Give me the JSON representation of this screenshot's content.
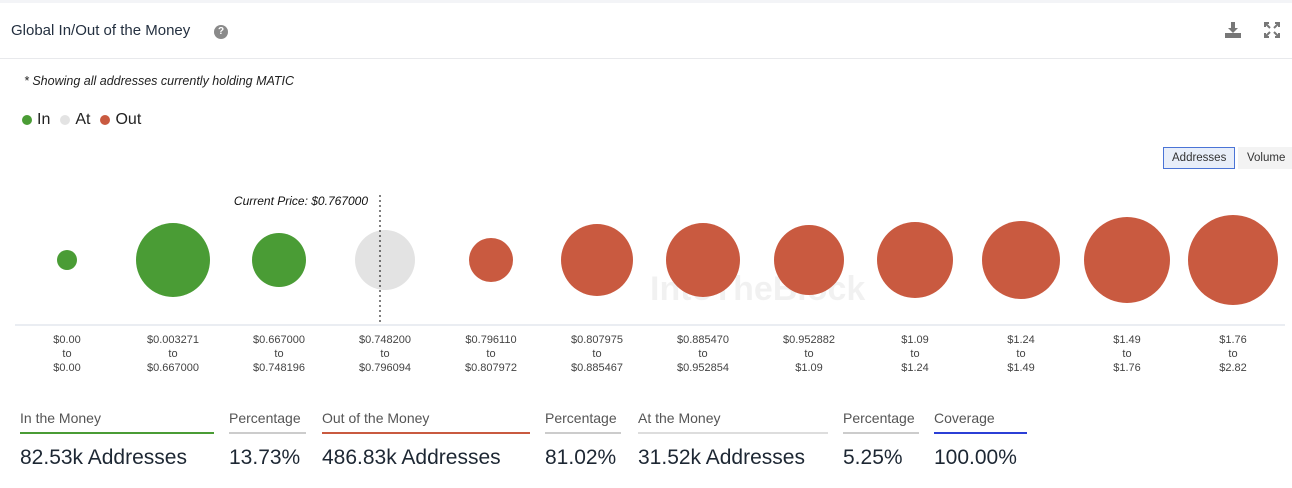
{
  "header": {
    "title": "Global In/Out of the Money",
    "help_icon": "question-circle-icon",
    "download_icon": "download-icon",
    "expand_icon": "expand-icon"
  },
  "note": "* Showing all addresses currently holding MATIC",
  "legend": [
    {
      "label": "In",
      "color": "#4a9c35"
    },
    {
      "label": "At",
      "color": "#e3e3e3"
    },
    {
      "label": "Out",
      "color": "#c95a40"
    }
  ],
  "toggles": {
    "addresses": "Addresses",
    "volume": "Volume",
    "active": "Addresses"
  },
  "watermark": "IntoTheBlock",
  "chart_data": {
    "type": "bubble",
    "current_price_label": "Current Price: $0.767000",
    "current_price_bucket_index": 3,
    "buckets": [
      {
        "from": "$0.00",
        "to": "$0.00",
        "status": "In",
        "relative_size": 10
      },
      {
        "from": "$0.003271",
        "to": "$0.667000",
        "status": "In",
        "relative_size": 37
      },
      {
        "from": "$0.667000",
        "to": "$0.748196",
        "status": "In",
        "relative_size": 27
      },
      {
        "from": "$0.748200",
        "to": "$0.796094",
        "status": "At",
        "relative_size": 30
      },
      {
        "from": "$0.796110",
        "to": "$0.807972",
        "status": "Out",
        "relative_size": 22
      },
      {
        "from": "$0.807975",
        "to": "$0.885467",
        "status": "Out",
        "relative_size": 36
      },
      {
        "from": "$0.885470",
        "to": "$0.952854",
        "status": "Out",
        "relative_size": 37
      },
      {
        "from": "$0.952882",
        "to": "$1.09",
        "status": "Out",
        "relative_size": 35
      },
      {
        "from": "$1.09",
        "to": "$1.24",
        "status": "Out",
        "relative_size": 38
      },
      {
        "from": "$1.24",
        "to": "$1.49",
        "status": "Out",
        "relative_size": 39
      },
      {
        "from": "$1.49",
        "to": "$1.76",
        "status": "Out",
        "relative_size": 43
      },
      {
        "from": "$1.76",
        "to": "$2.82",
        "status": "Out",
        "relative_size": 45
      }
    ],
    "to_word": "to"
  },
  "stats": [
    {
      "label": "In the Money",
      "value": "82.53k Addresses",
      "color": "#4a9c35"
    },
    {
      "label": "Percentage",
      "value": "13.73%",
      "color": "#cccccc"
    },
    {
      "label": "Out of the Money",
      "value": "486.83k Addresses",
      "color": "#c95a40"
    },
    {
      "label": "Percentage",
      "value": "81.02%",
      "color": "#cccccc"
    },
    {
      "label": "At the Money",
      "value": "31.52k Addresses",
      "color": "#dddddd"
    },
    {
      "label": "Percentage",
      "value": "5.25%",
      "color": "#cccccc"
    },
    {
      "label": "Coverage",
      "value": "100.00%",
      "color": "#2b3fd6"
    }
  ]
}
